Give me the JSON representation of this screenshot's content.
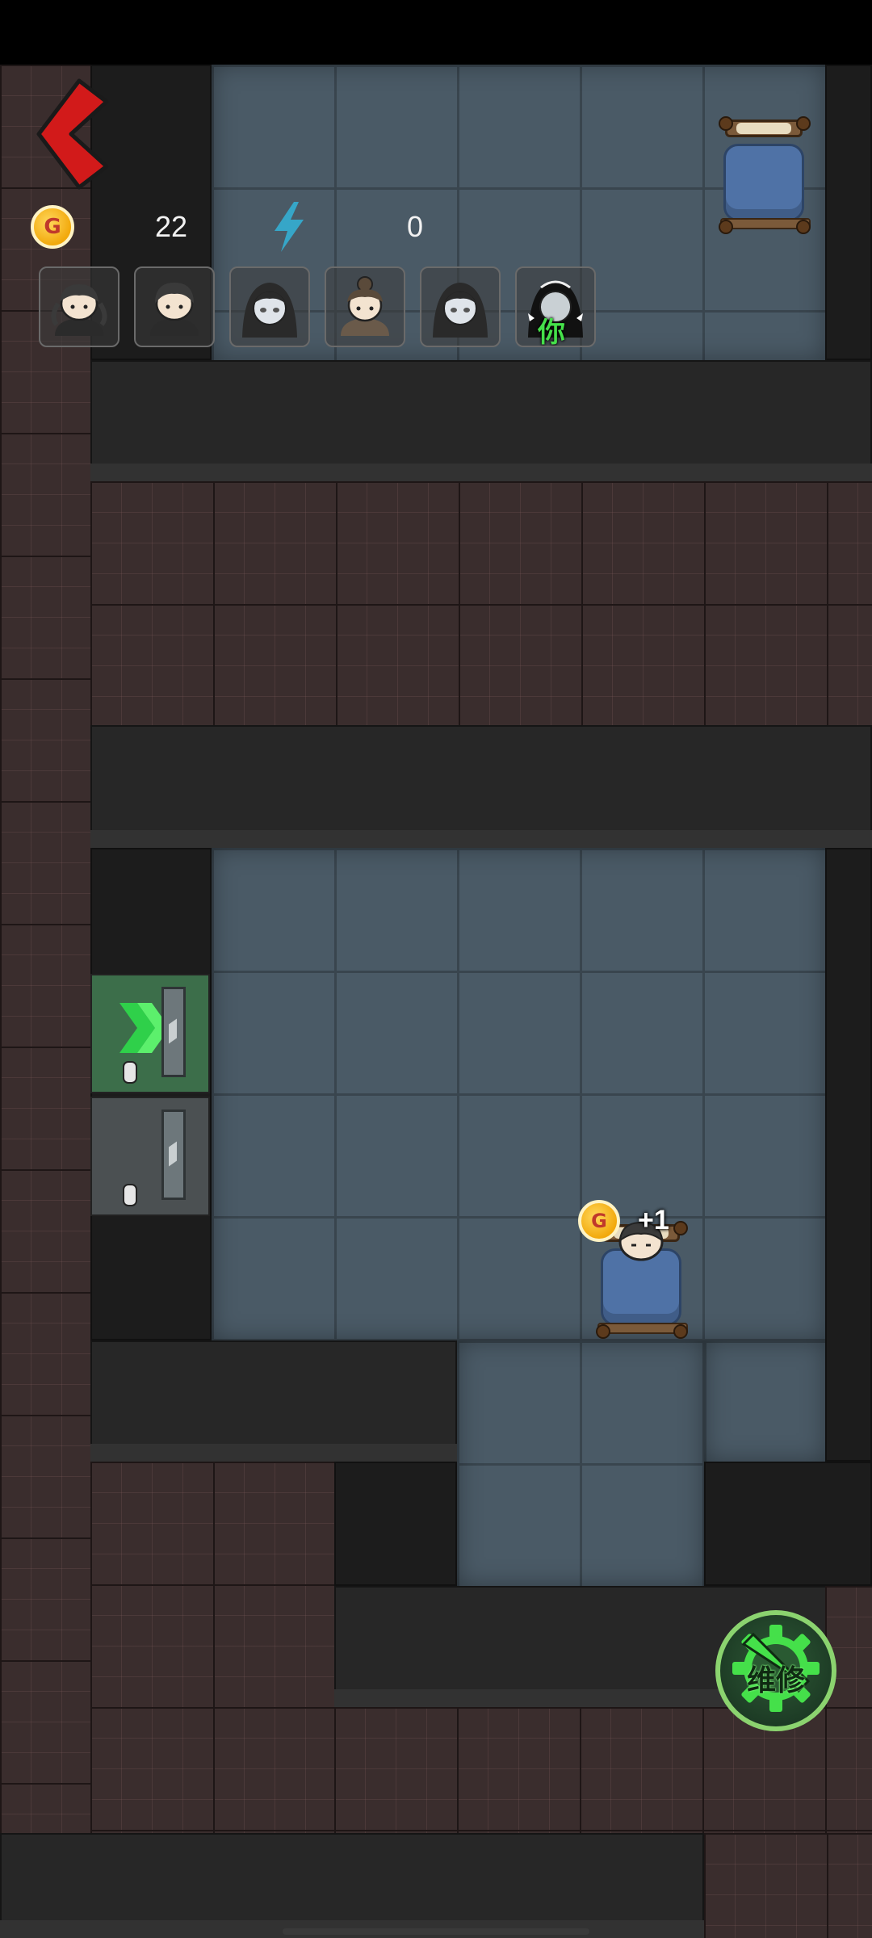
{
  "hud": {
    "coins": "22",
    "energy": "0",
    "coin_icon_text": "G",
    "icons": [
      "back-arrow-icon",
      "coin-icon",
      "lightning-icon"
    ]
  },
  "party": {
    "members": [
      {
        "name": "student-girl",
        "icon": "avatar-pigtail-girl"
      },
      {
        "name": "student-boy",
        "icon": "avatar-short-hair"
      },
      {
        "name": "ghost-girl",
        "icon": "avatar-ghost-pale"
      },
      {
        "name": "bun-girl",
        "icon": "avatar-bun-hair"
      },
      {
        "name": "ghost-girl-2",
        "icon": "avatar-ghost-pale"
      },
      {
        "name": "player",
        "icon": "avatar-player-highlighted"
      }
    ],
    "you_label": "你"
  },
  "events": {
    "coin_gain_text": "+1",
    "coin_gain_icon_text": "G"
  },
  "actions": {
    "repair_label": "维修"
  },
  "colors": {
    "back_arrow": "#d21a1a",
    "floor": "#4a5a66",
    "brick": "#3a2d2d",
    "repair_green": "#45e04a",
    "door_green": "#3c6e4a"
  }
}
